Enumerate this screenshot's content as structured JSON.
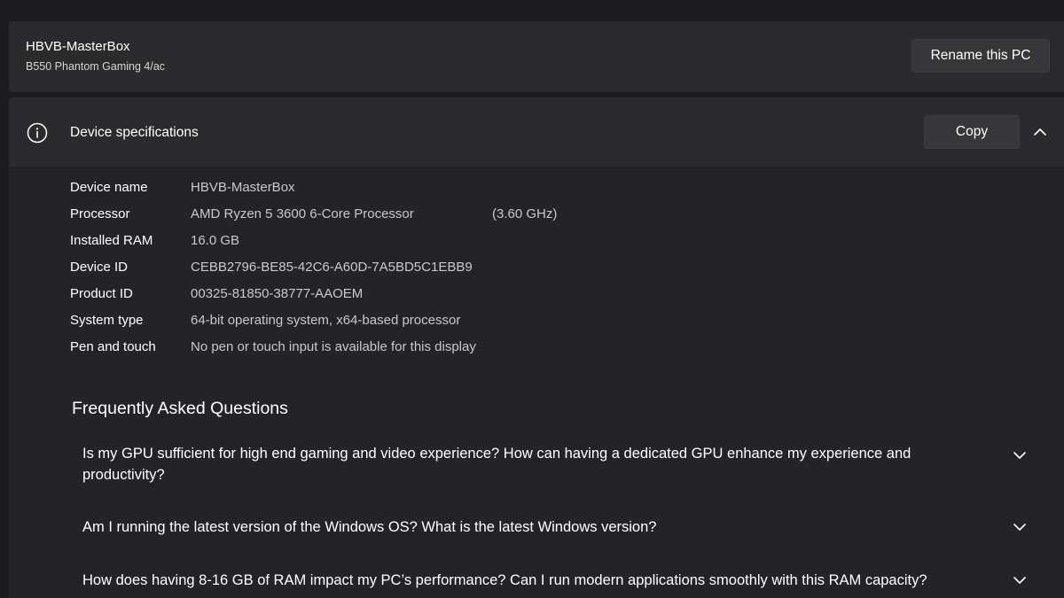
{
  "pc": {
    "name": "HBVB-MasterBox",
    "model": "B550 Phantom Gaming 4/ac",
    "rename_label": "Rename this PC"
  },
  "specs": {
    "title": "Device specifications",
    "copy_label": "Copy",
    "rows": [
      {
        "label": "Device name",
        "value": "HBVB-MasterBox",
        "extra": ""
      },
      {
        "label": "Processor",
        "value": "AMD Ryzen 5 3600 6-Core Processor",
        "extra": "(3.60 GHz)"
      },
      {
        "label": "Installed RAM",
        "value": "16.0 GB",
        "extra": ""
      },
      {
        "label": "Device ID",
        "value": "CEBB2796-BE85-42C6-A60D-7A5BD5C1EBB9",
        "extra": ""
      },
      {
        "label": "Product ID",
        "value": "00325-81850-38777-AAOEM",
        "extra": ""
      },
      {
        "label": "System type",
        "value": "64-bit operating system, x64-based processor",
        "extra": ""
      },
      {
        "label": "Pen and touch",
        "value": "No pen or touch input is available for this display",
        "extra": ""
      }
    ]
  },
  "faq": {
    "title": "Frequently Asked Questions",
    "items": [
      {
        "question": "Is my GPU sufficient for high end gaming and video experience? How can having a dedicated GPU enhance my experience and productivity?"
      },
      {
        "question": "Am I running the latest version of the Windows OS? What is the latest Windows version?"
      },
      {
        "question": "How does having 8-16 GB of RAM impact my PC’s performance? Can I run modern applications smoothly with this RAM capacity?"
      }
    ]
  },
  "icons": {
    "info": "info-icon",
    "collapse": "chevron-up-icon",
    "expand": "chevron-down-icon"
  },
  "colors": {
    "background": "#1c1c20",
    "card": "#2b2b2e",
    "button": "#373739"
  }
}
